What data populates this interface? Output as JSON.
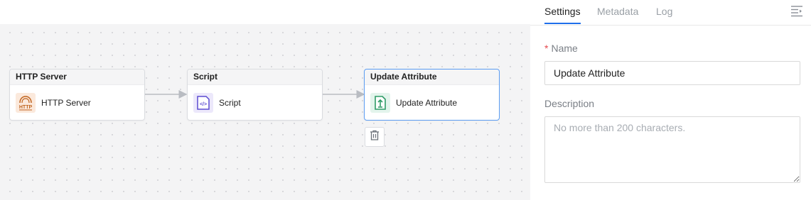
{
  "canvas": {
    "nodes": [
      {
        "title": "HTTP Server",
        "label": "HTTP Server",
        "icon": "http-server-icon",
        "icon_text": "HTTP",
        "color": "#c0641f"
      },
      {
        "title": "Script",
        "label": "Script",
        "icon": "script-icon",
        "icon_text": "</>",
        "color": "#5b4bd1"
      },
      {
        "title": "Update Attribute",
        "label": "Update Attribute",
        "icon": "update-attribute-icon",
        "color": "#2e9b66",
        "selected": true
      }
    ],
    "delete_icon": "trash-icon",
    "accent_color": "#5b9cf2"
  },
  "panel": {
    "tabs": [
      {
        "label": "Settings",
        "active": true
      },
      {
        "label": "Metadata",
        "active": false
      },
      {
        "label": "Log",
        "active": false
      }
    ],
    "collapse_icon": "collapse-panel-icon",
    "name_field": {
      "required_mark": "*",
      "label": "Name",
      "value": "Update Attribute"
    },
    "description_field": {
      "label": "Description",
      "value": "",
      "placeholder": "No more than 200 characters."
    },
    "tab_accent_color": "#1f6feb"
  }
}
